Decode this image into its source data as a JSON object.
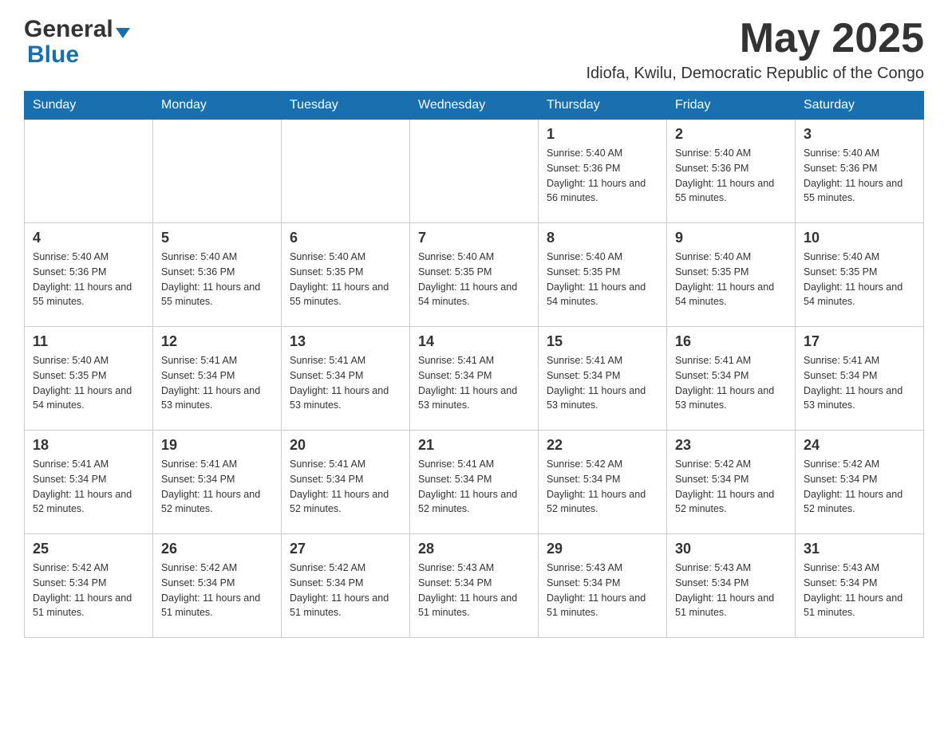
{
  "header": {
    "logo": {
      "general": "General",
      "blue": "Blue",
      "triangle": "▼"
    },
    "month_title": "May 2025",
    "location": "Idiofa, Kwilu, Democratic Republic of the Congo"
  },
  "days_of_week": [
    "Sunday",
    "Monday",
    "Tuesday",
    "Wednesday",
    "Thursday",
    "Friday",
    "Saturday"
  ],
  "weeks": [
    [
      {
        "day": "",
        "sunrise": "",
        "sunset": "",
        "daylight": ""
      },
      {
        "day": "",
        "sunrise": "",
        "sunset": "",
        "daylight": ""
      },
      {
        "day": "",
        "sunrise": "",
        "sunset": "",
        "daylight": ""
      },
      {
        "day": "",
        "sunrise": "",
        "sunset": "",
        "daylight": ""
      },
      {
        "day": "1",
        "sunrise": "Sunrise: 5:40 AM",
        "sunset": "Sunset: 5:36 PM",
        "daylight": "Daylight: 11 hours and 56 minutes."
      },
      {
        "day": "2",
        "sunrise": "Sunrise: 5:40 AM",
        "sunset": "Sunset: 5:36 PM",
        "daylight": "Daylight: 11 hours and 55 minutes."
      },
      {
        "day": "3",
        "sunrise": "Sunrise: 5:40 AM",
        "sunset": "Sunset: 5:36 PM",
        "daylight": "Daylight: 11 hours and 55 minutes."
      }
    ],
    [
      {
        "day": "4",
        "sunrise": "Sunrise: 5:40 AM",
        "sunset": "Sunset: 5:36 PM",
        "daylight": "Daylight: 11 hours and 55 minutes."
      },
      {
        "day": "5",
        "sunrise": "Sunrise: 5:40 AM",
        "sunset": "Sunset: 5:36 PM",
        "daylight": "Daylight: 11 hours and 55 minutes."
      },
      {
        "day": "6",
        "sunrise": "Sunrise: 5:40 AM",
        "sunset": "Sunset: 5:35 PM",
        "daylight": "Daylight: 11 hours and 55 minutes."
      },
      {
        "day": "7",
        "sunrise": "Sunrise: 5:40 AM",
        "sunset": "Sunset: 5:35 PM",
        "daylight": "Daylight: 11 hours and 54 minutes."
      },
      {
        "day": "8",
        "sunrise": "Sunrise: 5:40 AM",
        "sunset": "Sunset: 5:35 PM",
        "daylight": "Daylight: 11 hours and 54 minutes."
      },
      {
        "day": "9",
        "sunrise": "Sunrise: 5:40 AM",
        "sunset": "Sunset: 5:35 PM",
        "daylight": "Daylight: 11 hours and 54 minutes."
      },
      {
        "day": "10",
        "sunrise": "Sunrise: 5:40 AM",
        "sunset": "Sunset: 5:35 PM",
        "daylight": "Daylight: 11 hours and 54 minutes."
      }
    ],
    [
      {
        "day": "11",
        "sunrise": "Sunrise: 5:40 AM",
        "sunset": "Sunset: 5:35 PM",
        "daylight": "Daylight: 11 hours and 54 minutes."
      },
      {
        "day": "12",
        "sunrise": "Sunrise: 5:41 AM",
        "sunset": "Sunset: 5:34 PM",
        "daylight": "Daylight: 11 hours and 53 minutes."
      },
      {
        "day": "13",
        "sunrise": "Sunrise: 5:41 AM",
        "sunset": "Sunset: 5:34 PM",
        "daylight": "Daylight: 11 hours and 53 minutes."
      },
      {
        "day": "14",
        "sunrise": "Sunrise: 5:41 AM",
        "sunset": "Sunset: 5:34 PM",
        "daylight": "Daylight: 11 hours and 53 minutes."
      },
      {
        "day": "15",
        "sunrise": "Sunrise: 5:41 AM",
        "sunset": "Sunset: 5:34 PM",
        "daylight": "Daylight: 11 hours and 53 minutes."
      },
      {
        "day": "16",
        "sunrise": "Sunrise: 5:41 AM",
        "sunset": "Sunset: 5:34 PM",
        "daylight": "Daylight: 11 hours and 53 minutes."
      },
      {
        "day": "17",
        "sunrise": "Sunrise: 5:41 AM",
        "sunset": "Sunset: 5:34 PM",
        "daylight": "Daylight: 11 hours and 53 minutes."
      }
    ],
    [
      {
        "day": "18",
        "sunrise": "Sunrise: 5:41 AM",
        "sunset": "Sunset: 5:34 PM",
        "daylight": "Daylight: 11 hours and 52 minutes."
      },
      {
        "day": "19",
        "sunrise": "Sunrise: 5:41 AM",
        "sunset": "Sunset: 5:34 PM",
        "daylight": "Daylight: 11 hours and 52 minutes."
      },
      {
        "day": "20",
        "sunrise": "Sunrise: 5:41 AM",
        "sunset": "Sunset: 5:34 PM",
        "daylight": "Daylight: 11 hours and 52 minutes."
      },
      {
        "day": "21",
        "sunrise": "Sunrise: 5:41 AM",
        "sunset": "Sunset: 5:34 PM",
        "daylight": "Daylight: 11 hours and 52 minutes."
      },
      {
        "day": "22",
        "sunrise": "Sunrise: 5:42 AM",
        "sunset": "Sunset: 5:34 PM",
        "daylight": "Daylight: 11 hours and 52 minutes."
      },
      {
        "day": "23",
        "sunrise": "Sunrise: 5:42 AM",
        "sunset": "Sunset: 5:34 PM",
        "daylight": "Daylight: 11 hours and 52 minutes."
      },
      {
        "day": "24",
        "sunrise": "Sunrise: 5:42 AM",
        "sunset": "Sunset: 5:34 PM",
        "daylight": "Daylight: 11 hours and 52 minutes."
      }
    ],
    [
      {
        "day": "25",
        "sunrise": "Sunrise: 5:42 AM",
        "sunset": "Sunset: 5:34 PM",
        "daylight": "Daylight: 11 hours and 51 minutes."
      },
      {
        "day": "26",
        "sunrise": "Sunrise: 5:42 AM",
        "sunset": "Sunset: 5:34 PM",
        "daylight": "Daylight: 11 hours and 51 minutes."
      },
      {
        "day": "27",
        "sunrise": "Sunrise: 5:42 AM",
        "sunset": "Sunset: 5:34 PM",
        "daylight": "Daylight: 11 hours and 51 minutes."
      },
      {
        "day": "28",
        "sunrise": "Sunrise: 5:43 AM",
        "sunset": "Sunset: 5:34 PM",
        "daylight": "Daylight: 11 hours and 51 minutes."
      },
      {
        "day": "29",
        "sunrise": "Sunrise: 5:43 AM",
        "sunset": "Sunset: 5:34 PM",
        "daylight": "Daylight: 11 hours and 51 minutes."
      },
      {
        "day": "30",
        "sunrise": "Sunrise: 5:43 AM",
        "sunset": "Sunset: 5:34 PM",
        "daylight": "Daylight: 11 hours and 51 minutes."
      },
      {
        "day": "31",
        "sunrise": "Sunrise: 5:43 AM",
        "sunset": "Sunset: 5:34 PM",
        "daylight": "Daylight: 11 hours and 51 minutes."
      }
    ]
  ]
}
